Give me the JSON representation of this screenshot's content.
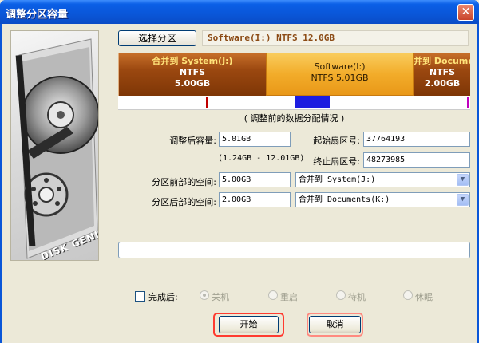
{
  "window": {
    "title": "调整分区容量",
    "close": "✕"
  },
  "art_text": "DISK GENIUS",
  "top": {
    "select_button": "选择分区",
    "current_partition": "Software(I:) NTFS 12.0GB"
  },
  "bar": {
    "segments": [
      {
        "line1": "合并到 System(J:)",
        "line2": "NTFS",
        "line3": "5.00GB"
      },
      {
        "line1": "Software(I:)",
        "line2": "NTFS 5.01GB",
        "line3": ""
      },
      {
        "line1": "合并到 Documents",
        "line2": "NTFS",
        "line3": "2.00GB"
      }
    ]
  },
  "caption": "( 调整前的数据分配情况 )",
  "form": {
    "size_label": "调整后容量:",
    "size_value": "5.01GB",
    "range": "(1.24GB - 12.01GB)",
    "start_label": "起始扇区号:",
    "start_value": "37764193",
    "end_label": "终止扇区号:",
    "end_value": "48273985",
    "front_label": "分区前部的空间:",
    "front_value": "5.00GB",
    "front_action": "合并到 System(J:)",
    "rear_label": "分区后部的空间:",
    "rear_value": "2.00GB",
    "rear_action": "合并到 Documents(K:)"
  },
  "after": {
    "label": "完成后:",
    "options": [
      "关机",
      "重启",
      "待机",
      "休眠"
    ]
  },
  "buttons": {
    "start": "开始",
    "cancel": "取消"
  }
}
